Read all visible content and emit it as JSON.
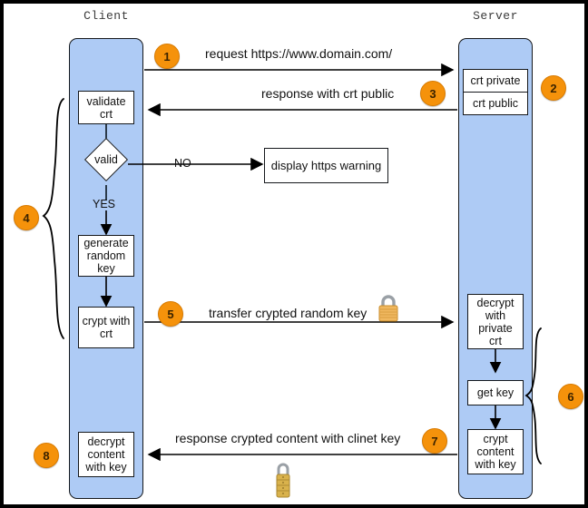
{
  "diagram": {
    "title_client": "Client",
    "title_server": "Server",
    "lanes": {
      "client": {
        "label": "Client"
      },
      "server": {
        "label": "Server"
      }
    },
    "client_nodes": {
      "validate": "validate\ncrt",
      "validate_l1": "validate",
      "validate_l2": "crt",
      "decision": "valid",
      "yes_label": "YES",
      "no_label": "NO",
      "generate_l1": "generate",
      "generate_l2": "random",
      "generate_l3": "key",
      "crypt_l1": "crypt with",
      "crypt_l2": "crt",
      "decrypt_l1": "decrypt",
      "decrypt_l2": "content",
      "decrypt_l3": "with key"
    },
    "server_nodes": {
      "crt_private": "crt private",
      "crt_public": "crt public",
      "decrypt_l1": "decrypt",
      "decrypt_l2": "with",
      "decrypt_l3": "private",
      "decrypt_l4": "crt",
      "get_key": "get key",
      "crypt_l1": "crypt",
      "crypt_l2": "content",
      "crypt_l3": "with key"
    },
    "external_nodes": {
      "https_warning": "display https warning"
    },
    "messages": {
      "m1": "request https://www.domain.com/",
      "m3": "response with crt public",
      "m5": "transfer crypted random key",
      "m7": "response crypted content with clinet key"
    },
    "badges": {
      "b1": "1",
      "b2": "2",
      "b3": "3",
      "b4": "4",
      "b5": "5",
      "b6": "6",
      "b7": "7",
      "b8": "8"
    },
    "icons": {
      "padlock_transfer": "padlock-icon",
      "padlock_response": "combination-padlock-icon"
    },
    "colors": {
      "lane_fill": "#aecbf5",
      "badge": "#f5920b",
      "stroke": "#15181c",
      "padlock_body": "#e8a33d",
      "padlock_shackle": "#9aa0a6"
    }
  }
}
